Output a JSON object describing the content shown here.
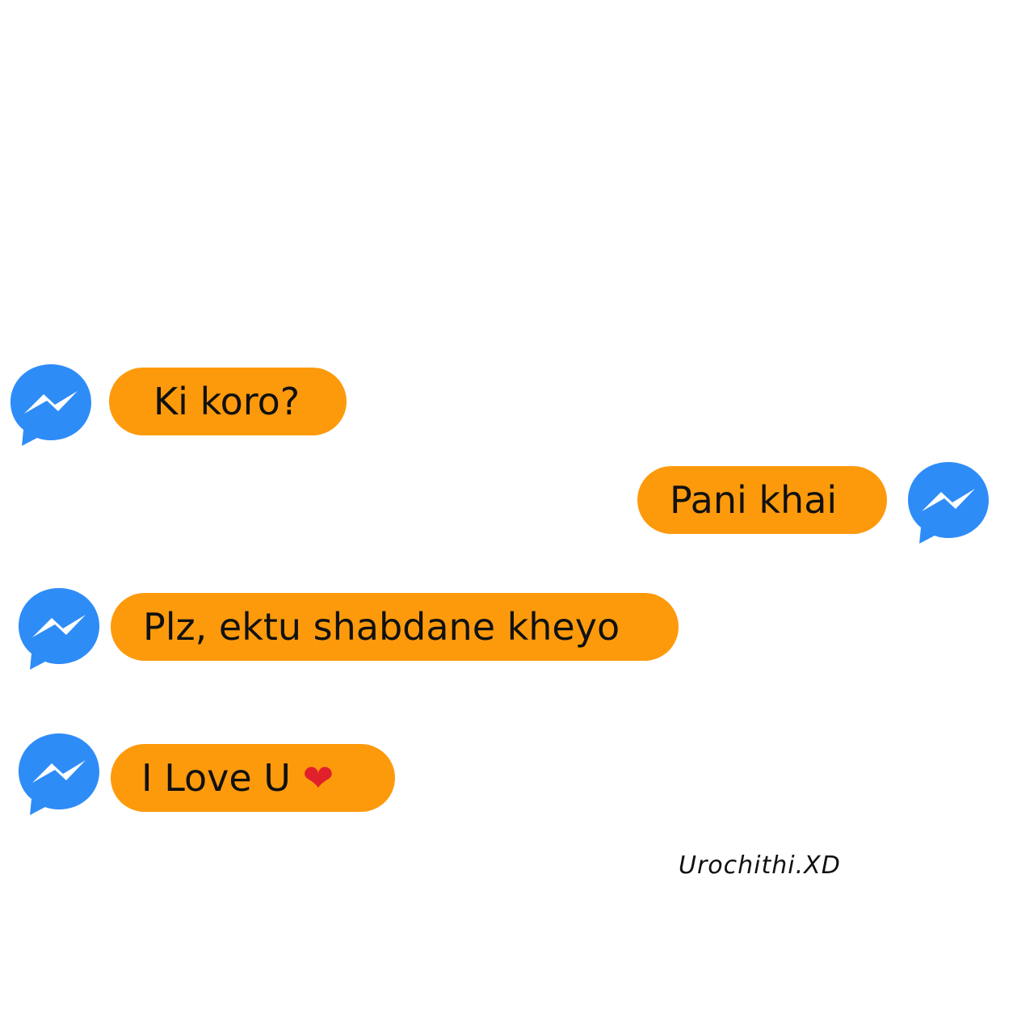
{
  "colors": {
    "bubble": "#FD9A0C",
    "messenger_blue": "#2E8CF7",
    "background": "#FFFFFF"
  },
  "messages": [
    {
      "text": "Ki koro?",
      "side": "left",
      "icon": "messenger-icon"
    },
    {
      "text": "Pani khai",
      "side": "right",
      "icon": "messenger-icon"
    },
    {
      "text": "Plz, ektu shabdane kheyo",
      "side": "left",
      "icon": "messenger-icon"
    },
    {
      "text": "I Love U",
      "emoji": "❤",
      "side": "left",
      "icon": "messenger-icon"
    }
  ],
  "watermark": "Urochithi.XD"
}
